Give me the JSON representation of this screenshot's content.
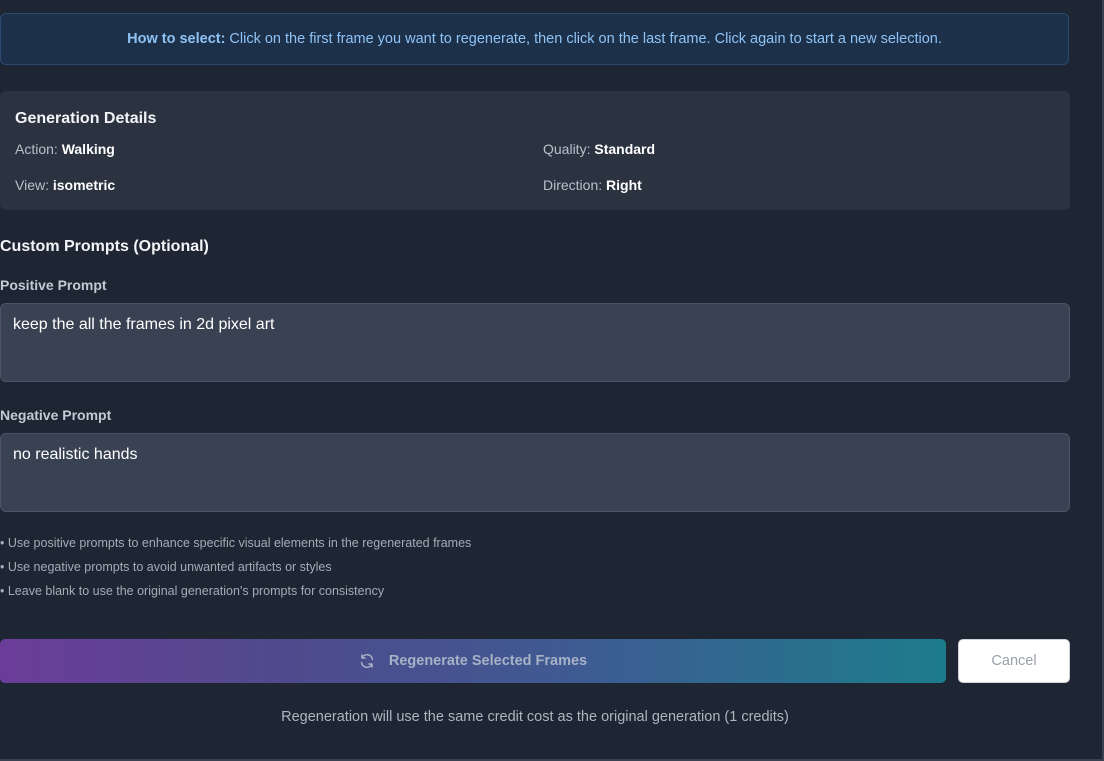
{
  "banner": {
    "bold": "How to select:",
    "text": "Click on the first frame you want to regenerate, then click on the last frame. Click again to start a new selection."
  },
  "details": {
    "title": "Generation Details",
    "action_label": "Action:",
    "action_value": "Walking",
    "quality_label": "Quality:",
    "quality_value": "Standard",
    "view_label": "View:",
    "view_value": "isometric",
    "direction_label": "Direction:",
    "direction_value": "Right"
  },
  "prompts": {
    "section_title": "Custom Prompts (Optional)",
    "positive_label": "Positive Prompt",
    "positive_value": "keep the all the frames in 2d pixel art",
    "negative_label": "Negative Prompt",
    "negative_value": "no realistic hands"
  },
  "tips": [
    "• Use positive prompts to enhance specific visual elements in the regenerated frames",
    "• Use negative prompts to avoid unwanted artifacts or styles",
    "• Leave blank to use the original generation's prompts for consistency"
  ],
  "actions": {
    "regenerate_label": "Regenerate Selected Frames",
    "regenerate_icon": "refresh-icon",
    "cancel_label": "Cancel"
  },
  "footnote": "Regeneration will use the same credit cost as the original generation (1 credits)",
  "colors": {
    "background": "#1e2533",
    "banner_text": "#8fc3f5",
    "panel": "#2b3341",
    "gradient_start": "#6b3d98",
    "gradient_end": "#1d7c8c"
  }
}
